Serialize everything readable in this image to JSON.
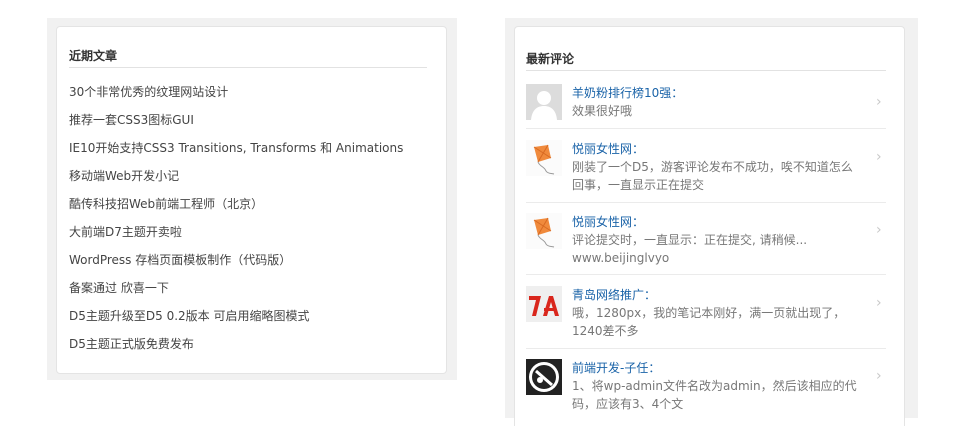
{
  "recent_posts": {
    "title": "近期文章",
    "items": [
      "30个非常优秀的纹理网站设计",
      "推荐一套CSS3图标GUI",
      "IE10开始支持CSS3 Transitions, Transforms 和 Animations",
      "移动端Web开发小记",
      "酷传科技招Web前端工程师（北京）",
      "大前端D7主题开卖啦",
      "WordPress 存档页面模板制作（代码版）",
      "备案通过 欣喜一下",
      "D5主题升级至D5 0.2版本 可启用缩略图模式",
      "D5主题正式版免费发布"
    ]
  },
  "recent_comments": {
    "title": "最新评论",
    "items": [
      {
        "author": "羊奶粉排行榜10强：",
        "text": "效果很好哦",
        "avatar": "default-avatar-icon"
      },
      {
        "author": "悦丽女性网：",
        "text": "刚装了一个D5，游客评论发布不成功，唉不知道怎么回事，一直显示正在提交",
        "avatar": "kite-avatar-icon"
      },
      {
        "author": "悦丽女性网：",
        "text": "评论提交时，一直显示：正在提交, 请稍候... www.beijinglvyo",
        "avatar": "kite-avatar-icon"
      },
      {
        "author": "青岛网络推广：",
        "text": "哦，1280px，我的笔记本刚好，满一页就出现了，1240差不多",
        "avatar": "red-logo-avatar-icon"
      },
      {
        "author": "前端开发-子任：",
        "text": "1、将wp-admin文件名改为admin，然后该相应的代码，应该有3、4个文",
        "avatar": "black-logo-avatar-icon"
      }
    ],
    "chevron": "›"
  }
}
